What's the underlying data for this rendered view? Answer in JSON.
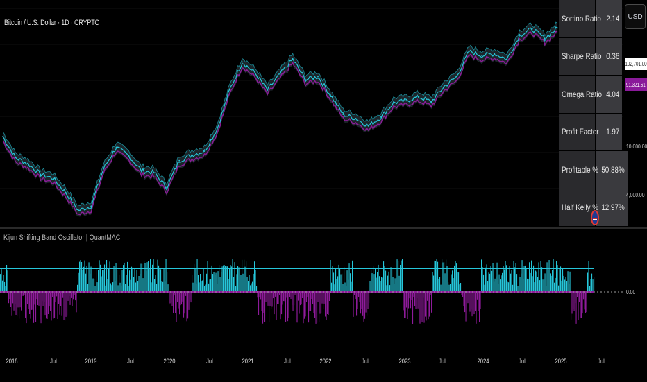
{
  "symbol": {
    "title": "Bitcoin / U.S. Dollar · 1D · CRYPTO"
  },
  "indicator": {
    "title": "Kijun Shifting Band Oscillator | QuantMAC"
  },
  "stats": [
    {
      "label": "Sortino Ratio",
      "value": "2.14"
    },
    {
      "label": "Sharpe Ratio",
      "value": "0.36"
    },
    {
      "label": "Omega Ratio",
      "value": "4.04"
    },
    {
      "label": "Profit Factor",
      "value": "1.97"
    },
    {
      "label": "Profitable %",
      "value": "50.88%"
    },
    {
      "label": "Half Kelly %",
      "value": "12.97%"
    }
  ],
  "price_scale": {
    "currency": "USD",
    "last_price_tag": "102,701.00",
    "band_price_tag": "91,321.61",
    "labels": [
      "10,000.00",
      "4,000.00"
    ],
    "oscillator_zero": "0.00"
  },
  "x_axis": {
    "ticks": [
      "2018",
      "Jul",
      "2019",
      "Jul",
      "2020",
      "Jul",
      "2021",
      "Jul",
      "2022",
      "Jul",
      "2023",
      "Jul",
      "2024",
      "Jul",
      "2025",
      "Jul"
    ]
  },
  "colors": {
    "background": "#000000",
    "bull": "#26c6da",
    "bear": "#8e1b9a",
    "band_fill": "#263238",
    "zero_line": "#9e9e9e"
  },
  "icons": {
    "flag": "us-flag-icon"
  },
  "chart_data": [
    {
      "type": "line",
      "title": "Bitcoin / U.S. Dollar · 1D · CRYPTO",
      "scale": "log",
      "x": [
        "2018-01",
        "2018-03",
        "2018-05",
        "2018-07",
        "2018-09",
        "2018-11",
        "2019-01",
        "2019-03",
        "2019-05",
        "2019-07",
        "2019-09",
        "2019-11",
        "2020-01",
        "2020-03",
        "2020-05",
        "2020-07",
        "2020-09",
        "2020-11",
        "2021-01",
        "2021-03",
        "2021-05",
        "2021-07",
        "2021-09",
        "2021-11",
        "2022-01",
        "2022-03",
        "2022-05",
        "2022-07",
        "2022-09",
        "2022-11",
        "2023-01",
        "2023-03",
        "2023-05",
        "2023-07",
        "2023-09",
        "2023-11",
        "2024-01",
        "2024-03",
        "2024-05",
        "2024-07",
        "2024-09",
        "2024-11",
        "2025-01",
        "2025-03",
        "2025-05"
      ],
      "series": [
        {
          "values": [
            14000,
            9500,
            8500,
            7000,
            6500,
            5000,
            3600,
            3900,
            7800,
            11500,
            9800,
            7500,
            7200,
            5500,
            9000,
            10000,
            10700,
            16000,
            33000,
            55000,
            45000,
            33000,
            44000,
            58000,
            40000,
            42000,
            30000,
            21000,
            19500,
            17000,
            20000,
            26000,
            27000,
            29000,
            26500,
            35000,
            42000,
            67000,
            62000,
            64000,
            58000,
            90000,
            101000,
            85000,
            102701
          ]
        }
      ]
    },
    {
      "type": "bar",
      "title": "Kijun Shifting Band Oscillator | QuantMAC",
      "note_zero": "0.00"
    }
  ]
}
